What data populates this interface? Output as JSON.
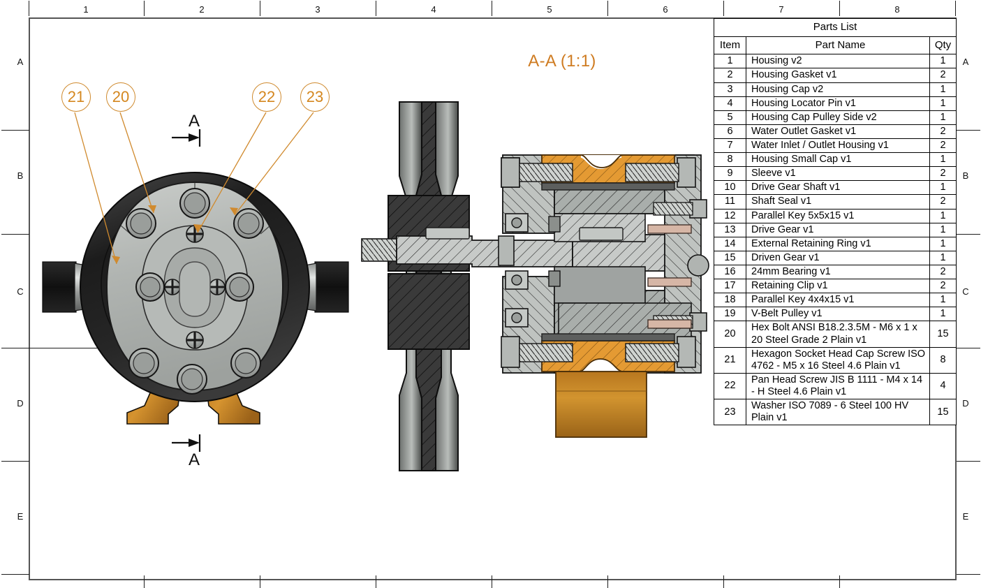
{
  "sheet": {
    "zone_numbers": [
      "1",
      "2",
      "3",
      "4",
      "5",
      "6",
      "7",
      "8"
    ],
    "zone_letters": [
      "A",
      "B",
      "C",
      "D",
      "E"
    ],
    "frame_color": "#555555",
    "accent_color": "#cf7c22"
  },
  "section": {
    "title": "A-A (1:1)",
    "cut_letter_top": "A",
    "cut_letter_bottom": "A"
  },
  "balloons": [
    {
      "label": "21"
    },
    {
      "label": "20"
    },
    {
      "label": "22"
    },
    {
      "label": "23"
    }
  ],
  "parts_list": {
    "title": "Parts List",
    "headers": {
      "item": "Item",
      "name": "Part Name",
      "qty": "Qty"
    },
    "rows": [
      {
        "item": "1",
        "name": "Housing v2",
        "qty": "1"
      },
      {
        "item": "2",
        "name": "Housing Gasket v1",
        "qty": "2"
      },
      {
        "item": "3",
        "name": "Housing Cap v2",
        "qty": "1"
      },
      {
        "item": "4",
        "name": "Housing Locator Pin v1",
        "qty": "1"
      },
      {
        "item": "5",
        "name": "Housing Cap Pulley Side v2",
        "qty": "1"
      },
      {
        "item": "6",
        "name": "Water Outlet Gasket v1",
        "qty": "2"
      },
      {
        "item": "7",
        "name": "Water Inlet / Outlet Housing v1",
        "qty": "2"
      },
      {
        "item": "8",
        "name": "Housing Small Cap v1",
        "qty": "1"
      },
      {
        "item": "9",
        "name": "Sleeve v1",
        "qty": "2"
      },
      {
        "item": "10",
        "name": "Drive Gear Shaft v1",
        "qty": "1"
      },
      {
        "item": "11",
        "name": "Shaft Seal v1",
        "qty": "2"
      },
      {
        "item": "12",
        "name": "Parallel Key 5x5x15 v1",
        "qty": "1"
      },
      {
        "item": "13",
        "name": "Drive Gear v1",
        "qty": "1"
      },
      {
        "item": "14",
        "name": "External Retaining Ring v1",
        "qty": "1"
      },
      {
        "item": "15",
        "name": "Driven Gear v1",
        "qty": "1"
      },
      {
        "item": "16",
        "name": "24mm Bearing v1",
        "qty": "2"
      },
      {
        "item": "17",
        "name": "Retaining Clip v1",
        "qty": "2"
      },
      {
        "item": "18",
        "name": "Parallel Key 4x4x15 v1",
        "qty": "1"
      },
      {
        "item": "19",
        "name": "V-Belt Pulley v1",
        "qty": "1"
      },
      {
        "item": "20",
        "name": "Hex Bolt ANSI B18.2.3.5M - M6 x 1 x 20 Steel Grade 2 Plain v1",
        "qty": "15"
      },
      {
        "item": "21",
        "name": "Hexagon Socket Head Cap Screw ISO 4762 - M5 x 16 Steel 4.6 Plain v1",
        "qty": "8"
      },
      {
        "item": "22",
        "name": "Pan Head Screw JIS B 1111 - M4 x 14 - H Steel 4.6 Plain v1",
        "qty": "4"
      },
      {
        "item": "23",
        "name": "Washer ISO 7089 - 6 Steel 100 HV Plain v1",
        "qty": "15"
      }
    ]
  }
}
